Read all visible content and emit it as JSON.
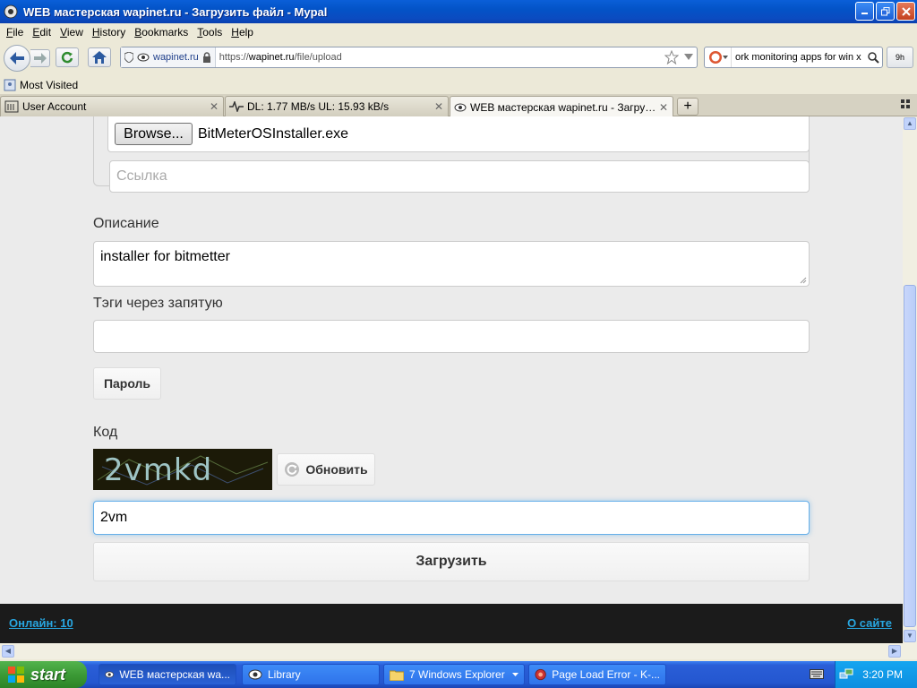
{
  "window": {
    "title": "WEB мастерская wapinet.ru - Загрузить файл - Mypal"
  },
  "menu": [
    "File",
    "Edit",
    "View",
    "History",
    "Bookmarks",
    "Tools",
    "Help"
  ],
  "nav": {
    "site_identity": "wapinet.ru",
    "url_prefix": "https://",
    "url_host": "wapinet.ru",
    "url_path": "/file/upload",
    "search_text": "ork monitoring apps for win x",
    "addon_label": "9h"
  },
  "bookmarks": {
    "most_visited": "Most Visited"
  },
  "tabs": [
    {
      "label": "User Account"
    },
    {
      "label": "DL: 1.77 MB/s UL: 15.93 kB/s"
    },
    {
      "label": "WEB мастерская wapinet.ru - Загрузит..."
    }
  ],
  "form": {
    "browse_label": "Browse...",
    "file_name": "BitMeterOSInstaller.exe",
    "link_placeholder": "Ссылка",
    "description_label": "Описание",
    "description_value": "installer for bitmetter",
    "tags_label": "Тэги через запятую",
    "tags_value": "",
    "password_button": "Пароль",
    "code_label": "Код",
    "captcha_text": "2vmkd",
    "refresh_button": "Обновить",
    "code_value": "2vm",
    "submit_button": "Загрузить"
  },
  "footer": {
    "online": "Онлайн: 10",
    "about": "О сайте"
  },
  "taskbar": {
    "start": "start",
    "items": [
      {
        "label": "WEB мастерская wa..."
      },
      {
        "label": "Library"
      },
      {
        "label": "7 Windows Explorer"
      },
      {
        "label": "Page Load Error - K-..."
      }
    ],
    "clock": "3:20 PM"
  },
  "colors": {
    "link": "#28a6e0",
    "footer_bg": "#1b1b1b",
    "page_bg": "#ebebeb",
    "focus_border": "#66afe9"
  }
}
